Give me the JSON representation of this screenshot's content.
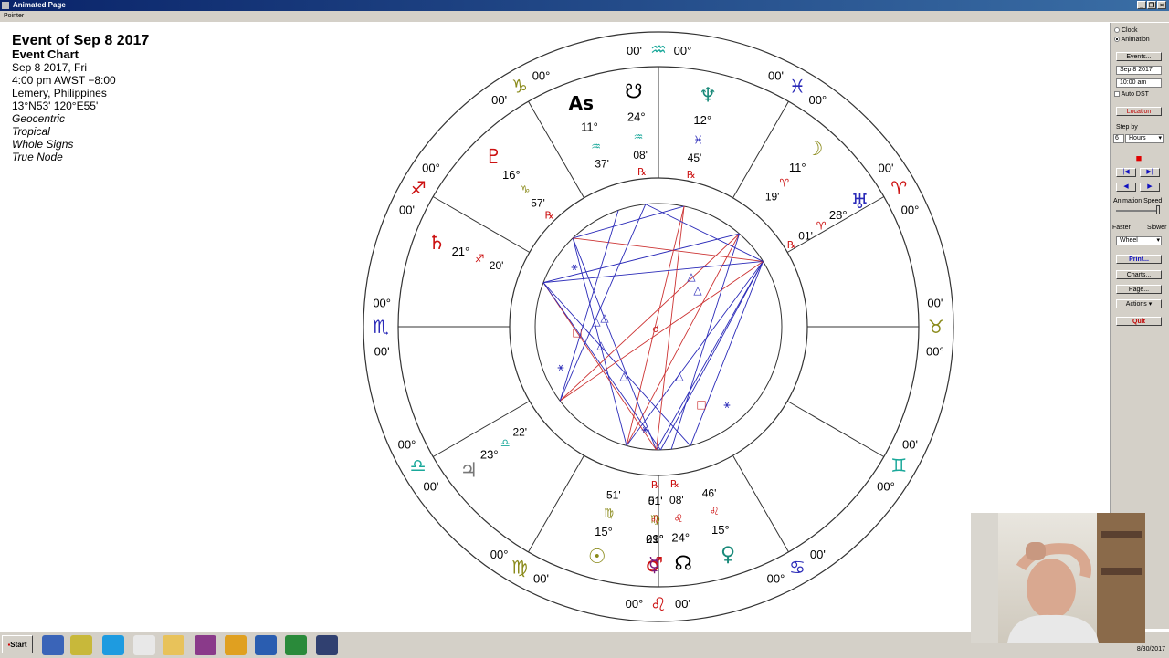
{
  "window": {
    "title": "Animated Page"
  },
  "menu": {
    "pointer": "Pointer"
  },
  "chart_info": {
    "title": "Event of Sep 8 2017",
    "subtitle": "Event Chart",
    "date": "Sep 8 2017, Fri",
    "time": "4:00 pm  AWST −8:00",
    "place": "Lemery, Philippines",
    "coords": "13°N53' 120°E55'",
    "options": [
      "Geocentric",
      "Tropical",
      "Whole Signs",
      "True Node"
    ]
  },
  "wheel": {
    "cusp_degree": "00°",
    "cusp_minute": "00'",
    "signs": [
      {
        "name": "taurus-sign",
        "glyph": "♉",
        "color": "#8a8a1a"
      },
      {
        "name": "aries-sign",
        "glyph": "♈",
        "color": "#cc1111"
      },
      {
        "name": "pisces-sign",
        "glyph": "♓",
        "color": "#2a2ab8"
      },
      {
        "name": "aquarius-sign",
        "glyph": "♒",
        "color": "#1aa89a"
      },
      {
        "name": "capricorn-sign",
        "glyph": "♑",
        "color": "#8a8a1a"
      },
      {
        "name": "sagittarius-sign",
        "glyph": "♐",
        "color": "#cc1111"
      },
      {
        "name": "scorpio-sign",
        "glyph": "♏",
        "color": "#2a2ab8"
      },
      {
        "name": "libra-sign",
        "glyph": "♎",
        "color": "#1aa89a"
      },
      {
        "name": "virgo-sign",
        "glyph": "♍",
        "color": "#8a8a1a"
      },
      {
        "name": "leo-sign",
        "glyph": "♌",
        "color": "#cc1111"
      },
      {
        "name": "cancer-sign",
        "glyph": "♋",
        "color": "#2a2ab8"
      },
      {
        "name": "gemini-sign",
        "glyph": "♊",
        "color": "#1aa89a"
      }
    ],
    "planets": [
      {
        "name": "uranus",
        "glyph": "♅",
        "color": "#2a2ab8",
        "deg": "28°",
        "sign": "♈",
        "sign_color": "#cc1111",
        "min": "01'",
        "rx": "℞"
      },
      {
        "name": "moon",
        "glyph": "☽",
        "color": "#8a8a1a",
        "deg": "11°",
        "sign": "♈",
        "sign_color": "#cc1111",
        "min": "19'",
        "rx": ""
      },
      {
        "name": "neptune",
        "glyph": "♆",
        "color": "#1a8a7a",
        "deg": "12°",
        "sign": "♓",
        "sign_color": "#2a2ab8",
        "min": "45'",
        "rx": "℞"
      },
      {
        "name": "south-node",
        "glyph": "☋",
        "color": "#000000",
        "deg": "24°",
        "sign": "♒",
        "sign_color": "#1aa89a",
        "min": "08'",
        "rx": "℞"
      },
      {
        "name": "ascendant",
        "glyph": "As",
        "color": "#000000",
        "deg": "11°",
        "sign": "♒",
        "sign_color": "#1aa89a",
        "min": "37'",
        "rx": ""
      },
      {
        "name": "pluto",
        "glyph": "♇",
        "color": "#cc1111",
        "deg": "16°",
        "sign": "♑",
        "sign_color": "#8a8a1a",
        "min": "57'",
        "rx": "℞"
      },
      {
        "name": "saturn",
        "glyph": "♄",
        "color": "#cc1111",
        "deg": "21°",
        "sign": "♐",
        "sign_color": "#cc1111",
        "min": "20'",
        "rx": ""
      },
      {
        "name": "jupiter",
        "glyph": "♃",
        "color": "#777777",
        "deg": "23°",
        "sign": "♎",
        "sign_color": "#1aa89a",
        "min": "22'",
        "rx": ""
      },
      {
        "name": "sun",
        "glyph": "☉",
        "color": "#8a8a1a",
        "deg": "15°",
        "sign": "♍",
        "sign_color": "#8a8a1a",
        "min": "51'",
        "rx": ""
      },
      {
        "name": "mars",
        "glyph": "♂",
        "color": "#cc1111",
        "deg": "01°",
        "sign": "♍",
        "sign_color": "#8a8a1a",
        "min": "51'",
        "rx": ""
      },
      {
        "name": "mercury",
        "glyph": "☿",
        "color": "#7a1a7a",
        "deg": "29°",
        "sign": "♌",
        "sign_color": "#cc1111",
        "min": "01'",
        "rx": "℞"
      },
      {
        "name": "north-node",
        "glyph": "☊",
        "color": "#000000",
        "deg": "24°",
        "sign": "♌",
        "sign_color": "#cc1111",
        "min": "08'",
        "rx": "℞"
      },
      {
        "name": "venus",
        "glyph": "♀",
        "color": "#1a8a7a",
        "deg": "15°",
        "sign": "♌",
        "sign_color": "#cc1111",
        "min": "46'",
        "rx": ""
      }
    ],
    "aspect_symbols": {
      "trine": "△",
      "sextile": "⚹",
      "square": "□",
      "conjunction": "☌"
    },
    "colors": {
      "hard_aspect": "#cc3333",
      "soft_aspect": "#2a2ab8",
      "ring": "#333333"
    }
  },
  "panel": {
    "clock": "Clock",
    "animation": "Animation",
    "events": "Events...",
    "date_value": "Sep 8 2017",
    "time_value": "10:00 am",
    "auto_dst": "Auto DST",
    "location": "Location",
    "step_by": "Step by",
    "step_value": "6",
    "step_unit": "Hours",
    "animation_speed": "Animation Speed",
    "faster": "Faster",
    "slower": "Slower",
    "view_mode": "Wheel",
    "print": "Print...",
    "charts": "Charts...",
    "page": "Page...",
    "actions": "Actions",
    "quit": "Quit"
  },
  "taskbar": {
    "start": "Start",
    "date": "8/30/2017"
  }
}
